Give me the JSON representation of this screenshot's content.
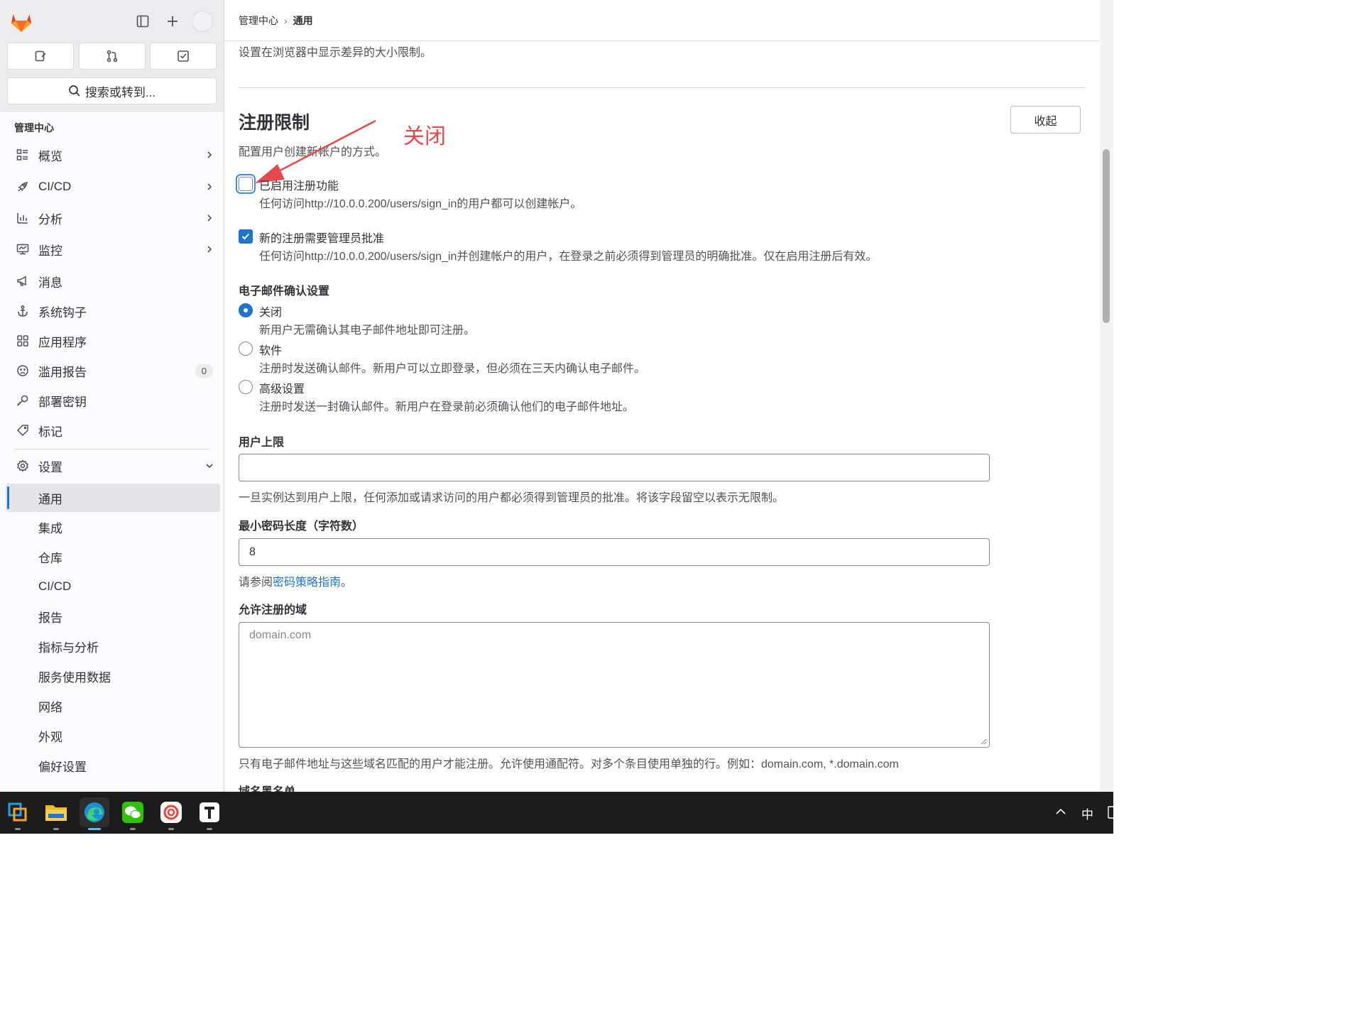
{
  "breadcrumb": {
    "root": "管理中心",
    "current": "通用"
  },
  "sidebar": {
    "search_label": "搜索或转到...",
    "section_title": "管理中心",
    "items": [
      {
        "label": "概览",
        "icon": "overview-icon",
        "chevron": true
      },
      {
        "label": "CI/CD",
        "icon": "rocket-icon",
        "chevron": true
      },
      {
        "label": "分析",
        "icon": "chart-icon",
        "chevron": true
      },
      {
        "label": "监控",
        "icon": "monitor-icon",
        "chevron": true
      },
      {
        "label": "消息",
        "icon": "bullhorn-icon"
      },
      {
        "label": "系统钩子",
        "icon": "anchor-icon"
      },
      {
        "label": "应用程序",
        "icon": "applications-icon"
      },
      {
        "label": "滥用报告",
        "icon": "abuse-icon",
        "badge": "0"
      },
      {
        "label": "部署密钥",
        "icon": "key-icon"
      },
      {
        "label": "标记",
        "icon": "label-icon"
      }
    ],
    "settings": {
      "label": "设置",
      "sub_items": [
        "通用",
        "集成",
        "仓库",
        "CI/CD",
        "报告",
        "指标与分析",
        "服务使用数据",
        "网络",
        "外观",
        "偏好设置"
      ],
      "active": "通用"
    }
  },
  "main": {
    "prev_section_desc": "设置在浏览器中显示差异的大小限制。",
    "section": {
      "title": "注册限制",
      "description": "配置用户创建新帐户的方式。",
      "collapse_label": "收起"
    },
    "annotation": "关闭",
    "checkboxes": [
      {
        "label": "已启用注册功能",
        "help": "任何访问http://10.0.0.200/users/sign_in的用户都可以创建帐户。",
        "checked": false
      },
      {
        "label": "新的注册需要管理员批准",
        "help": "任何访问http://10.0.0.200/users/sign_in并创建帐户的用户，在登录之前必须得到管理员的明确批准。仅在启用注册后有效。",
        "checked": true
      }
    ],
    "email_confirm": {
      "title": "电子邮件确认设置",
      "options": [
        {
          "label": "关闭",
          "help": "新用户无需确认其电子邮件地址即可注册。",
          "checked": true
        },
        {
          "label": "软件",
          "help": "注册时发送确认邮件。新用户可以立即登录，但必须在三天内确认电子邮件。",
          "checked": false
        },
        {
          "label": "高级设置",
          "help": "注册时发送一封确认邮件。新用户在登录前必须确认他们的电子邮件地址。",
          "checked": false
        }
      ]
    },
    "user_cap": {
      "label": "用户上限",
      "value": "",
      "help": "一旦实例达到用户上限，任何添加或请求访问的用户都必须得到管理员的批准。将该字段留空以表示无限制。"
    },
    "min_password": {
      "label": "最小密码长度（字符数）",
      "value": "8",
      "help_prefix": "请参阅",
      "help_link": "密码策略指南",
      "help_suffix": "。"
    },
    "allowed_domains": {
      "label": "允许注册的域",
      "placeholder": "domain.com",
      "help": "只有电子邮件地址与这些域名匹配的用户才能注册。允许使用通配符。对多个条目使用单独的行。例如：domain.com, *.domain.com"
    },
    "next_label": "域名黑名单"
  },
  "taskbar": {
    "apps": [
      "vmware-icon",
      "file-explorer-icon",
      "edge-icon",
      "wechat-icon",
      "app-icon",
      "typora-icon"
    ],
    "ime": "中"
  },
  "colors": {
    "accent": "#1f75cb",
    "annotation": "#e5484d"
  }
}
